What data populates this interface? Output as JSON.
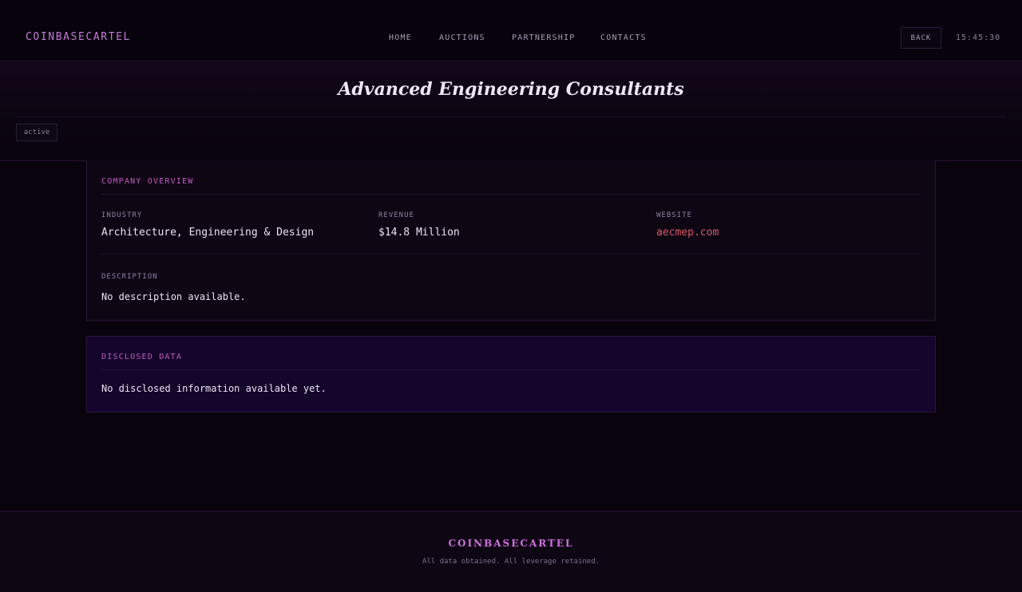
{
  "header": {
    "logo": "COINBASECARTEL",
    "nav": [
      {
        "label": "HOME"
      },
      {
        "label": "AUCTIONS"
      },
      {
        "label": "PARTNERSHIP"
      },
      {
        "label": "CONTACTS"
      }
    ],
    "back_label": "BACK",
    "time": "15:45:30"
  },
  "company": {
    "name": "Advanced Engineering Consultants",
    "status": "active"
  },
  "overview": {
    "heading": "COMPANY OVERVIEW",
    "industry_label": "INDUSTRY",
    "industry": "Architecture, Engineering & Design",
    "revenue_label": "REVENUE",
    "revenue": "$14.8 Million",
    "website_label": "WEBSITE",
    "website": "aecmep.com",
    "description_label": "DESCRIPTION",
    "description": "No description available."
  },
  "disclosed": {
    "heading": "DISCLOSED DATA",
    "text": "No disclosed information available yet."
  },
  "footer": {
    "brand": "COINBASECARTEL",
    "tagline": "All data obtained. All leverage retained."
  },
  "colors": {
    "background": "#08030d",
    "accent": "#c15bc4",
    "link": "#d65a66",
    "text": "#ece2f2",
    "muted": "#8f80a0"
  }
}
